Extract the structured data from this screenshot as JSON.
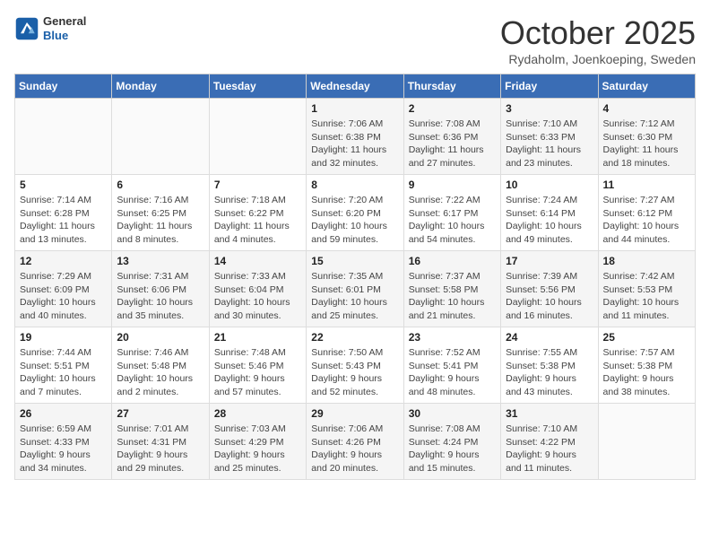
{
  "header": {
    "logo": {
      "line1": "General",
      "line2": "Blue"
    },
    "title": "October 2025",
    "location": "Rydaholm, Joenkoeping, Sweden"
  },
  "weekdays": [
    "Sunday",
    "Monday",
    "Tuesday",
    "Wednesday",
    "Thursday",
    "Friday",
    "Saturday"
  ],
  "weeks": [
    [
      {
        "day": "",
        "info": ""
      },
      {
        "day": "",
        "info": ""
      },
      {
        "day": "",
        "info": ""
      },
      {
        "day": "1",
        "info": "Sunrise: 7:06 AM\nSunset: 6:38 PM\nDaylight: 11 hours\nand 32 minutes."
      },
      {
        "day": "2",
        "info": "Sunrise: 7:08 AM\nSunset: 6:36 PM\nDaylight: 11 hours\nand 27 minutes."
      },
      {
        "day": "3",
        "info": "Sunrise: 7:10 AM\nSunset: 6:33 PM\nDaylight: 11 hours\nand 23 minutes."
      },
      {
        "day": "4",
        "info": "Sunrise: 7:12 AM\nSunset: 6:30 PM\nDaylight: 11 hours\nand 18 minutes."
      }
    ],
    [
      {
        "day": "5",
        "info": "Sunrise: 7:14 AM\nSunset: 6:28 PM\nDaylight: 11 hours\nand 13 minutes."
      },
      {
        "day": "6",
        "info": "Sunrise: 7:16 AM\nSunset: 6:25 PM\nDaylight: 11 hours\nand 8 minutes."
      },
      {
        "day": "7",
        "info": "Sunrise: 7:18 AM\nSunset: 6:22 PM\nDaylight: 11 hours\nand 4 minutes."
      },
      {
        "day": "8",
        "info": "Sunrise: 7:20 AM\nSunset: 6:20 PM\nDaylight: 10 hours\nand 59 minutes."
      },
      {
        "day": "9",
        "info": "Sunrise: 7:22 AM\nSunset: 6:17 PM\nDaylight: 10 hours\nand 54 minutes."
      },
      {
        "day": "10",
        "info": "Sunrise: 7:24 AM\nSunset: 6:14 PM\nDaylight: 10 hours\nand 49 minutes."
      },
      {
        "day": "11",
        "info": "Sunrise: 7:27 AM\nSunset: 6:12 PM\nDaylight: 10 hours\nand 44 minutes."
      }
    ],
    [
      {
        "day": "12",
        "info": "Sunrise: 7:29 AM\nSunset: 6:09 PM\nDaylight: 10 hours\nand 40 minutes."
      },
      {
        "day": "13",
        "info": "Sunrise: 7:31 AM\nSunset: 6:06 PM\nDaylight: 10 hours\nand 35 minutes."
      },
      {
        "day": "14",
        "info": "Sunrise: 7:33 AM\nSunset: 6:04 PM\nDaylight: 10 hours\nand 30 minutes."
      },
      {
        "day": "15",
        "info": "Sunrise: 7:35 AM\nSunset: 6:01 PM\nDaylight: 10 hours\nand 25 minutes."
      },
      {
        "day": "16",
        "info": "Sunrise: 7:37 AM\nSunset: 5:58 PM\nDaylight: 10 hours\nand 21 minutes."
      },
      {
        "day": "17",
        "info": "Sunrise: 7:39 AM\nSunset: 5:56 PM\nDaylight: 10 hours\nand 16 minutes."
      },
      {
        "day": "18",
        "info": "Sunrise: 7:42 AM\nSunset: 5:53 PM\nDaylight: 10 hours\nand 11 minutes."
      }
    ],
    [
      {
        "day": "19",
        "info": "Sunrise: 7:44 AM\nSunset: 5:51 PM\nDaylight: 10 hours\nand 7 minutes."
      },
      {
        "day": "20",
        "info": "Sunrise: 7:46 AM\nSunset: 5:48 PM\nDaylight: 10 hours\nand 2 minutes."
      },
      {
        "day": "21",
        "info": "Sunrise: 7:48 AM\nSunset: 5:46 PM\nDaylight: 9 hours\nand 57 minutes."
      },
      {
        "day": "22",
        "info": "Sunrise: 7:50 AM\nSunset: 5:43 PM\nDaylight: 9 hours\nand 52 minutes."
      },
      {
        "day": "23",
        "info": "Sunrise: 7:52 AM\nSunset: 5:41 PM\nDaylight: 9 hours\nand 48 minutes."
      },
      {
        "day": "24",
        "info": "Sunrise: 7:55 AM\nSunset: 5:38 PM\nDaylight: 9 hours\nand 43 minutes."
      },
      {
        "day": "25",
        "info": "Sunrise: 7:57 AM\nSunset: 5:38 PM\nDaylight: 9 hours\nand 38 minutes."
      }
    ],
    [
      {
        "day": "26",
        "info": "Sunrise: 6:59 AM\nSunset: 4:33 PM\nDaylight: 9 hours\nand 34 minutes."
      },
      {
        "day": "27",
        "info": "Sunrise: 7:01 AM\nSunset: 4:31 PM\nDaylight: 9 hours\nand 29 minutes."
      },
      {
        "day": "28",
        "info": "Sunrise: 7:03 AM\nSunset: 4:29 PM\nDaylight: 9 hours\nand 25 minutes."
      },
      {
        "day": "29",
        "info": "Sunrise: 7:06 AM\nSunset: 4:26 PM\nDaylight: 9 hours\nand 20 minutes."
      },
      {
        "day": "30",
        "info": "Sunrise: 7:08 AM\nSunset: 4:24 PM\nDaylight: 9 hours\nand 15 minutes."
      },
      {
        "day": "31",
        "info": "Sunrise: 7:10 AM\nSunset: 4:22 PM\nDaylight: 9 hours\nand 11 minutes."
      },
      {
        "day": "",
        "info": ""
      }
    ]
  ]
}
